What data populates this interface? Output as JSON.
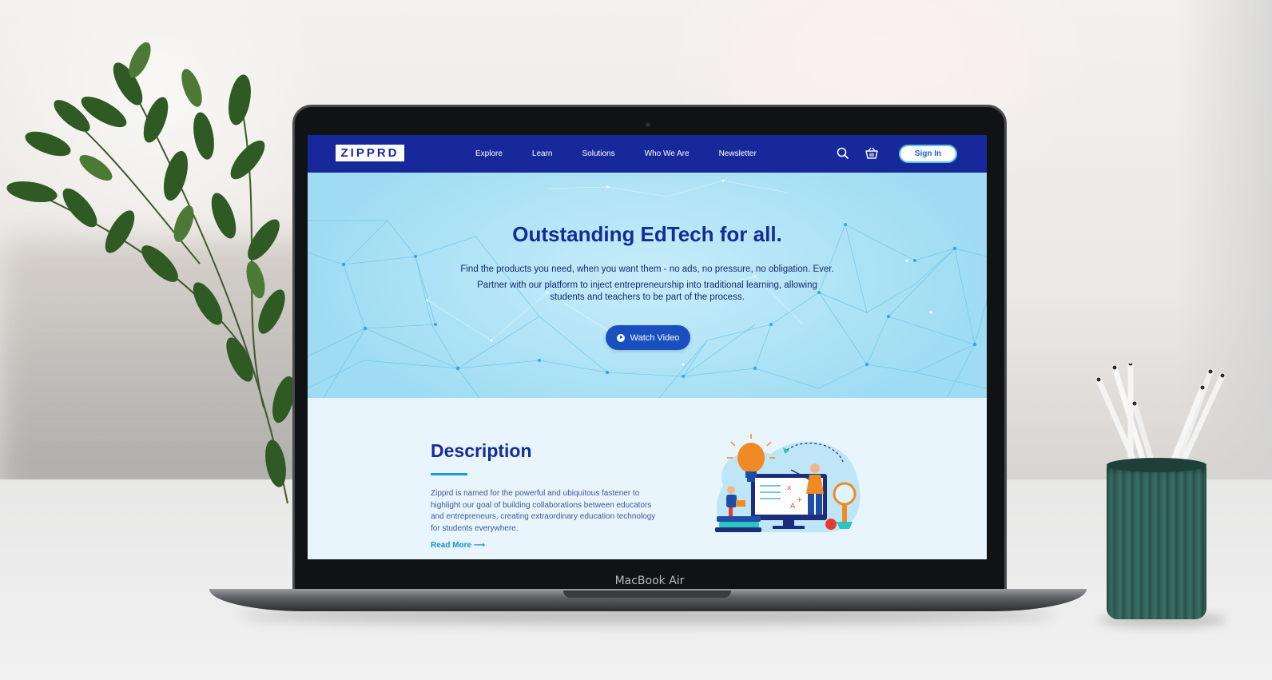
{
  "device": {
    "brand_label": "MacBook Air"
  },
  "navbar": {
    "logo": "ZIPPRD",
    "links": [
      "Explore",
      "Learn",
      "Solutions",
      "Who We Are",
      "Newsletter"
    ],
    "icons": [
      "search-icon",
      "cart-icon"
    ],
    "sign_in": "Sign In"
  },
  "hero": {
    "title": "Outstanding EdTech for all.",
    "line1": "Find the products you need, when you want them - no ads, no pressure, no obligation. Ever.",
    "line2": "Partner with our platform to inject entrepreneurship into traditional learning, allowing",
    "line3": "students and teachers to be part of the process.",
    "watch_video": "Watch Video"
  },
  "description": {
    "title": "Description",
    "text": "Zipprd is named for the powerful and ubiquitous fastener to highlight our goal of building collaborations between educators and entrepreneurs, creating extraordinary education technology for students everywhere.",
    "read_more": "Read More ⟶"
  },
  "colors": {
    "nav_bg": "#17299a",
    "brand_blue": "#142c96",
    "accent_blue": "#1e9be0",
    "hero_bg": "#aee3f6",
    "button_blue": "#1a4fbf"
  }
}
